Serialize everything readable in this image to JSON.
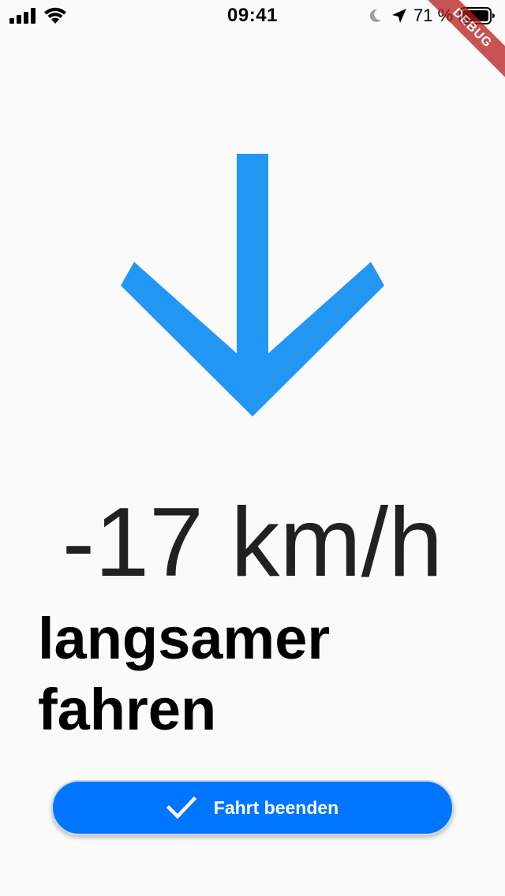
{
  "status_bar": {
    "time": "09:41",
    "battery_percent": "71 %",
    "icons": [
      "signal-icon",
      "wifi-icon",
      "moon-icon",
      "location-arrow-icon",
      "battery-icon"
    ]
  },
  "debug_banner": {
    "label": "DEBUG",
    "color": "#b71c1c"
  },
  "indicator": {
    "icon": "arrow-down-icon",
    "color": "#2196f3"
  },
  "speed": {
    "value": "-17 km/h"
  },
  "instruction": {
    "line1": "langsamer",
    "line2": "fahren"
  },
  "finish_button": {
    "label": "Fahrt beenden",
    "icon": "check-icon",
    "color": "#0075ff"
  }
}
